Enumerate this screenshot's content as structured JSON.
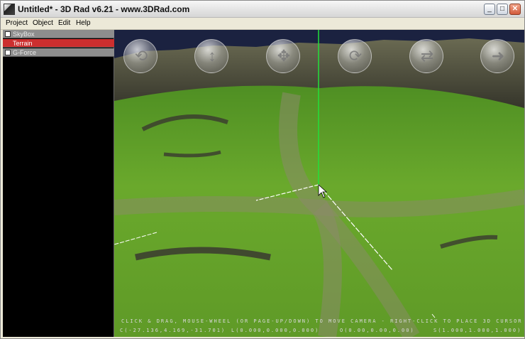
{
  "window": {
    "title": "Untitled* - 3D Rad v6.21 - www.3DRad.com",
    "controls": {
      "minimize": "_",
      "maximize": "□",
      "close": "✕"
    }
  },
  "menu": [
    "Project",
    "Object",
    "Edit",
    "Help"
  ],
  "objects": [
    {
      "label": "SkyBox",
      "selected": false
    },
    {
      "label": "Terrain",
      "selected": true
    },
    {
      "label": "G-Force",
      "selected": false
    }
  ],
  "viewport": {
    "nav_buttons": [
      "orbit-icon",
      "move-vertical-icon",
      "pan-icon",
      "rotate-icon",
      "rotate-horizontal-icon",
      "forward-icon"
    ],
    "help_text": "CLICK & DRAG, MOUSE-WHEEL (OR PAGE-UP/DOWN) TO MOVE CAMERA - RIGHT-CLICK TO PLACE 3D CURSOR",
    "status": {
      "cursor": "C(-27.136,4.169,-31.701)",
      "location": "L(0.000,0.000,0.000)",
      "orientation": "O(0.00,0.00,0.00)",
      "scale": "S(1.000,1.000,1.000)"
    }
  },
  "colors": {
    "selected_row": "#cc2f2f",
    "terrain_green": "#6fae2e",
    "axis_green": "#22e03a",
    "sky": "#1b2240"
  }
}
